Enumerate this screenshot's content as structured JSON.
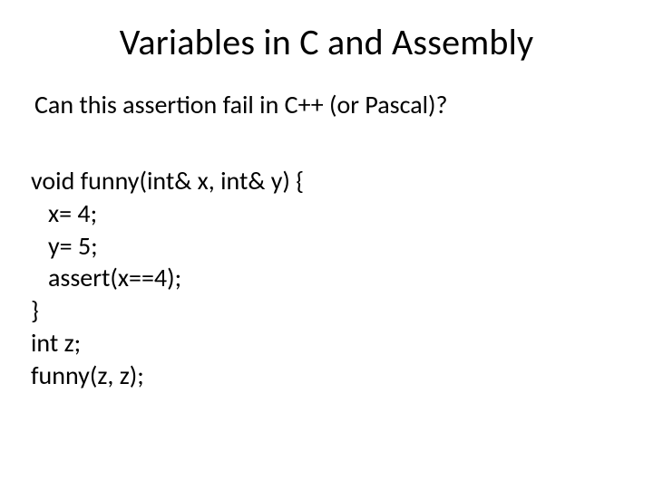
{
  "title": "Variables in C and Assembly",
  "subtitle": "Can this assertion fail in C++ (or Pascal)?",
  "code": {
    "l1": "void funny(int& x, int& y) {",
    "l2": "   x= 4;",
    "l3": "   y= 5;",
    "l4": "   assert(x==4);",
    "l5": "}",
    "l6": "int z;",
    "l7": "funny(z, z);"
  }
}
